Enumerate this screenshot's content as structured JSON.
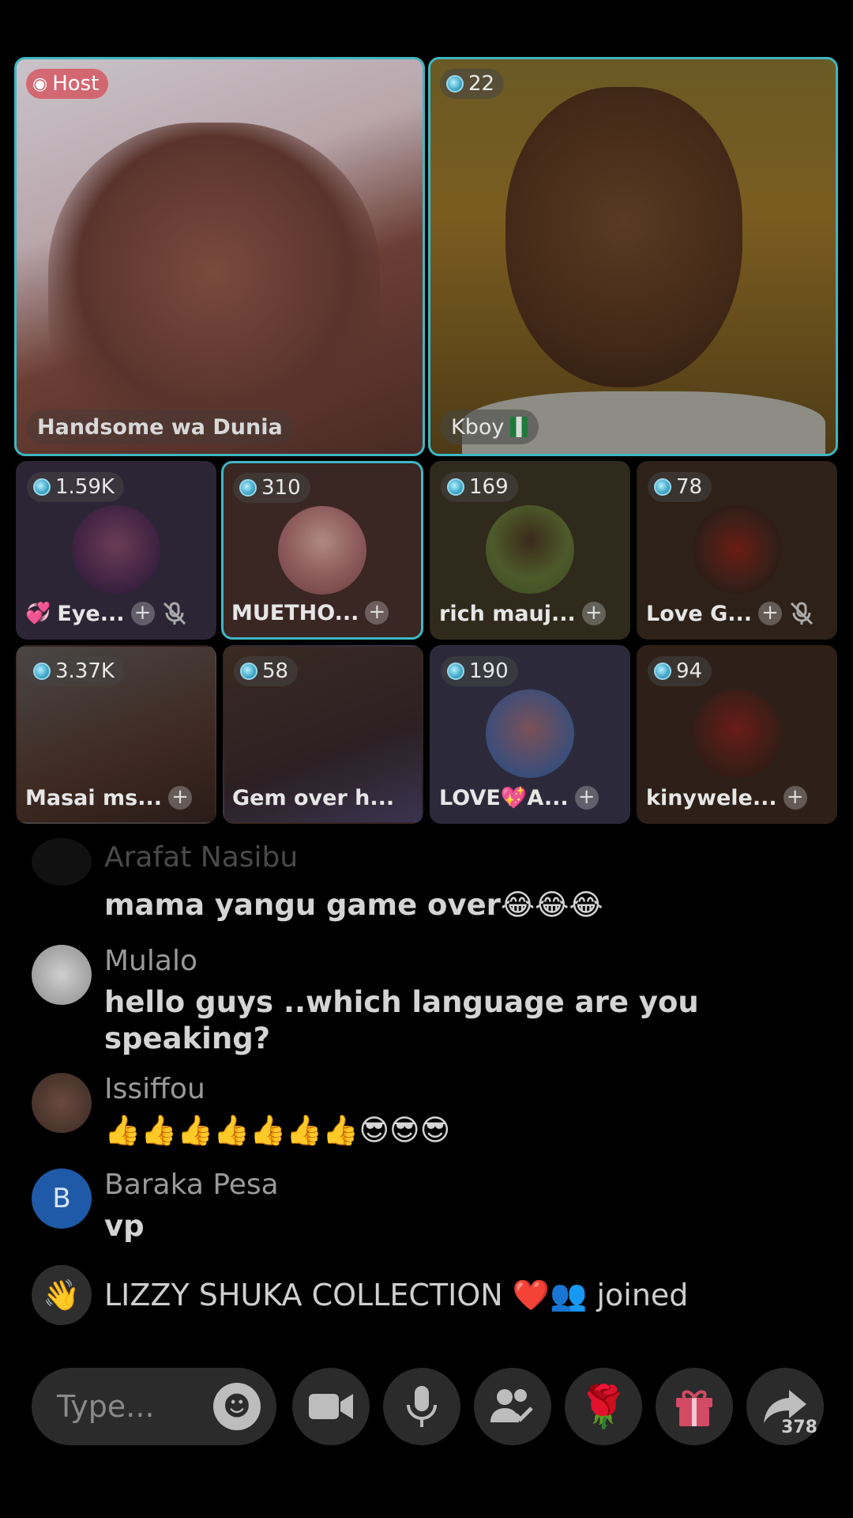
{
  "host_tile": {
    "badge": "Host",
    "name": "Handsome  wa  Dunia"
  },
  "guest_tile": {
    "count": "22",
    "name": "Kboy"
  },
  "small_tiles": [
    {
      "count": "1.59K",
      "name": "Eye...",
      "prefix_icon": "heart-icon",
      "muted": true
    },
    {
      "count": "310",
      "name": "MUETHO...",
      "muted": false,
      "active": true
    },
    {
      "count": "169",
      "name": "rich mauj...",
      "muted": false
    },
    {
      "count": "78",
      "name": "Love G...",
      "muted": true
    },
    {
      "count": "3.37K",
      "name": "Masai ms...",
      "muted": false
    },
    {
      "count": "58",
      "name": "Gem over h...",
      "muted": false
    },
    {
      "count": "190",
      "name": "LOVE💖A...",
      "muted": false
    },
    {
      "count": "94",
      "name": "kinywele...",
      "muted": false
    }
  ],
  "chat": {
    "faded_name": "Arafat Nasibu",
    "messages": [
      {
        "name": "",
        "text": "mama yangu game over😂😂😂"
      },
      {
        "name": "Mulalo",
        "text": "hello guys ..which language are you speaking?"
      },
      {
        "name": "Issiffou",
        "text": "👍👍👍👍👍👍👍😎😎😎"
      },
      {
        "name": "Baraka Pesa",
        "avatar_letter": "B",
        "text": "vp"
      }
    ],
    "join_notice": {
      "name": "LIZZY SHUKA COLLECTION ❤️👥",
      "action": "joined"
    }
  },
  "toolbar": {
    "input_placeholder": "Type...",
    "share_count": "378"
  },
  "colors": {
    "accent": "#3fb6c2",
    "host_badge": "#d74b55",
    "baraka_avatar": "#1f5aa8"
  }
}
